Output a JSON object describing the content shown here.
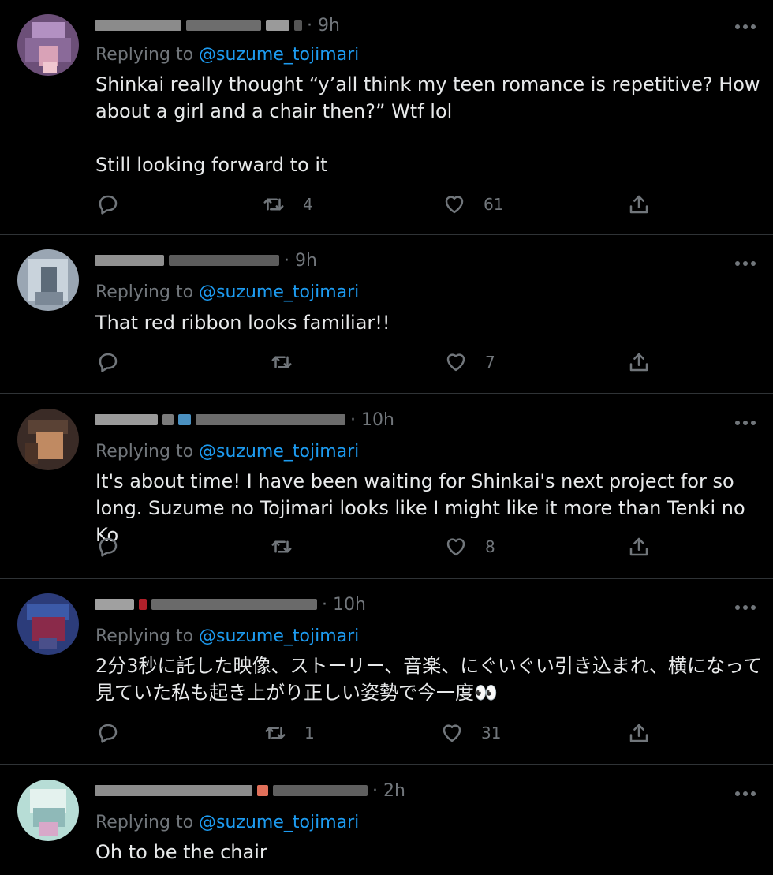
{
  "tweets": [
    {
      "time": "· 9h",
      "replying_to": "Replying to",
      "handle": "@suzume_tojimari",
      "text": "Shinkai really thought “y’all think my teen romance is repetitive? How about a girl and a chair then?” Wtf lol\n\nStill looking forward to it",
      "retweets": "4",
      "likes": "61"
    },
    {
      "time": "· 9h",
      "replying_to": "Replying to",
      "handle": "@suzume_tojimari",
      "text": "That red ribbon looks familiar!!",
      "retweets": "",
      "likes": "7"
    },
    {
      "time": "· 10h",
      "replying_to": "Replying to",
      "handle": "@suzume_tojimari",
      "text": "It's about time! I have been waiting for Shinkai's next project for so long. Suzume no Tojimari looks like I might like it more than Tenki no Ko",
      "retweets": "",
      "likes": "8"
    },
    {
      "time": "· 10h",
      "replying_to": "Replying to",
      "handle": "@suzume_tojimari",
      "text": "2分3秒に託した映像、ストーリー、音楽、にぐいぐい引き込まれ、横になって見ていた私も起き上がり正しい姿勢で今一度👀",
      "retweets": "1",
      "likes": "31"
    },
    {
      "time": "· 2h",
      "replying_to": "Replying to",
      "handle": "@suzume_tojimari",
      "text": "Oh to be the chair"
    }
  ],
  "colors": {
    "background": "#000000",
    "text": "#e7e9ea",
    "muted": "#71767b",
    "link": "#1d9bf0",
    "divider": "#2f3336"
  },
  "icons": [
    "reply-icon",
    "retweet-icon",
    "like-icon",
    "share-icon",
    "more-icon"
  ]
}
